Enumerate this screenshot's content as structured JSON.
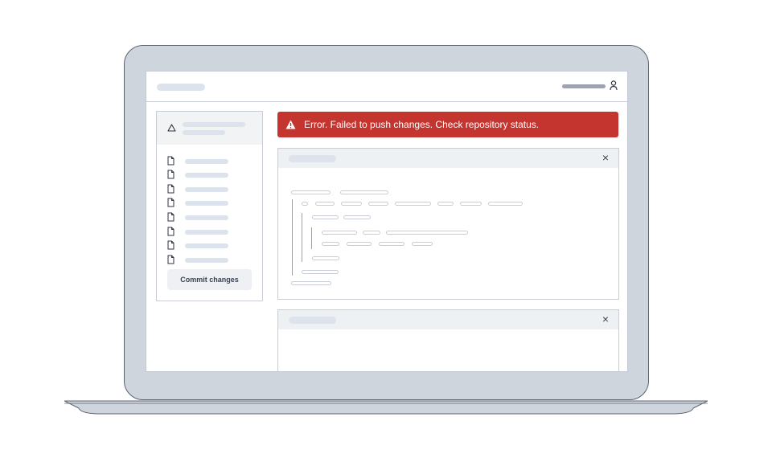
{
  "error_banner": {
    "message": "Error. Failed to push changes. Check repository status.",
    "color": "#c4352f"
  },
  "sidebar": {
    "commit_label": "Commit changes",
    "head_icon": "warning-triangle-outline-icon",
    "file_icon": "file-icon",
    "file_count": 8
  },
  "header": {
    "user_icon": "user-icon"
  },
  "panels": [
    {
      "close_label": "×"
    },
    {
      "close_label": "×"
    }
  ]
}
